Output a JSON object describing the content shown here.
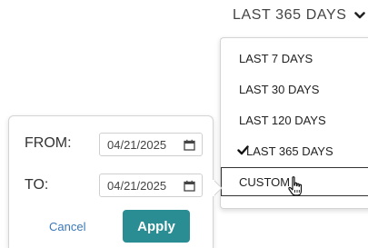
{
  "range_toggle": {
    "label": "LAST 365 DAYS",
    "icon": "chevron-down-icon"
  },
  "menu": {
    "items": [
      {
        "label": "LAST 7 DAYS",
        "checked": false
      },
      {
        "label": "LAST 30 DAYS",
        "checked": false
      },
      {
        "label": "LAST 120 DAYS",
        "checked": false
      },
      {
        "label": "LAST 365 DAYS",
        "checked": true
      },
      {
        "label": "CUSTOM",
        "checked": false,
        "hovered": true
      }
    ],
    "check_icon": "checkmark-icon"
  },
  "custom_range": {
    "from_label": "FROM:",
    "from_value": "04/21/2025",
    "to_label": "TO:",
    "to_value": "04/21/2025",
    "calendar_icon": "calendar-icon",
    "cancel_label": "Cancel",
    "apply_label": "Apply"
  },
  "colors": {
    "apply_bg": "#2a8d93",
    "cancel_link": "#3b78b8",
    "text": "#333333",
    "border": "#d4d4d4"
  }
}
